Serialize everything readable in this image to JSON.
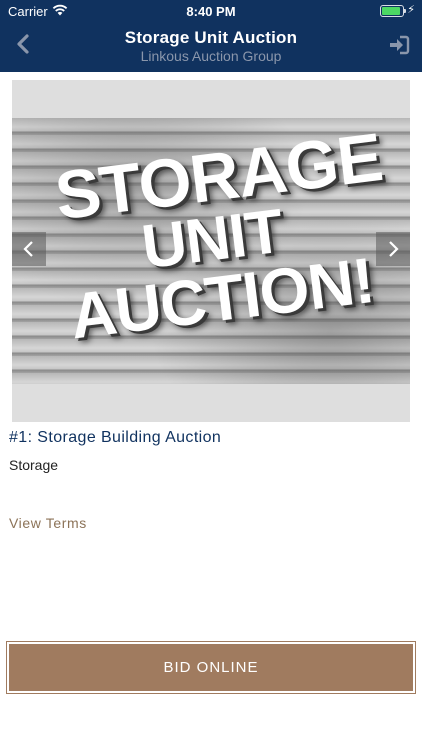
{
  "status_bar": {
    "carrier": "Carrier",
    "time": "8:40 PM",
    "bolt": "⚡"
  },
  "nav": {
    "title": "Storage Unit Auction",
    "subtitle": "Linkous Auction Group",
    "back_icon": "chevron-left-icon",
    "signin_icon": "sign-in-icon"
  },
  "gallery": {
    "image_text": [
      "STORAGE",
      "UNIT",
      "AUCTION!"
    ],
    "prev_icon": "chevron-left-icon",
    "next_icon": "chevron-right-icon"
  },
  "lot": {
    "title": "#1: Storage Building Auction",
    "category": "Storage",
    "terms_link": "View Terms"
  },
  "actions": {
    "bid_label": "BID ONLINE"
  },
  "colors": {
    "nav_bg": "#10325f",
    "accent_brown": "#a07b5f",
    "link_brown": "#8c7358",
    "title_navy": "#10325f"
  }
}
